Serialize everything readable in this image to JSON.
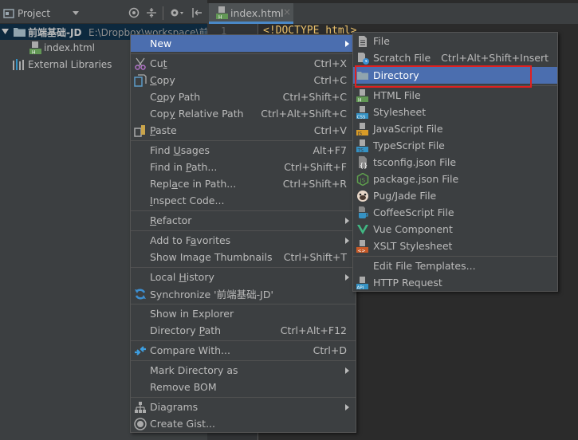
{
  "project_panel": {
    "title": "Project",
    "header_icons": [
      "project-icon",
      "dropdown-icon",
      "locate-icon",
      "collapse-icon",
      "gear-icon",
      "hide-icon"
    ],
    "root": {
      "name": "前端基础-JD",
      "path": "E:\\Dropbox\\workspace\\前"
    },
    "children": [
      {
        "name": "index.html",
        "icon": "html-file-icon"
      }
    ],
    "external": "External Libraries"
  },
  "editor": {
    "tab": {
      "label": "index.html",
      "close": "×"
    },
    "line_number": "1",
    "code_line": "<!DOCTYPE html>"
  },
  "context_menu": {
    "items": [
      {
        "label": "New",
        "submenu": true,
        "selected": true
      },
      {
        "sep": true
      },
      {
        "label": "Cut",
        "ul": "t",
        "shortcut": "Ctrl+X",
        "icon": "scissors-icon"
      },
      {
        "label": "Copy",
        "ul": "C",
        "shortcut": "Ctrl+C",
        "icon": "copy-icon"
      },
      {
        "label": "Copy Path",
        "shortcut": "Ctrl+Shift+C"
      },
      {
        "label": "Copy Relative Path",
        "shortcut": "Ctrl+Alt+Shift+C"
      },
      {
        "label": "Paste",
        "ul": "P",
        "shortcut": "Ctrl+V",
        "icon": "paste-icon"
      },
      {
        "sep": true
      },
      {
        "label": "Find Usages",
        "shortcut": "Alt+F7"
      },
      {
        "label": "Find in Path...",
        "shortcut": "Ctrl+Shift+F"
      },
      {
        "label": "Replace in Path...",
        "shortcut": "Ctrl+Shift+R"
      },
      {
        "label": "Inspect Code..."
      },
      {
        "sep": true
      },
      {
        "label": "Refactor",
        "submenu": true
      },
      {
        "sep": true
      },
      {
        "label": "Add to Favorites",
        "submenu": true
      },
      {
        "label": "Show Image Thumbnails",
        "shortcut": "Ctrl+Shift+T"
      },
      {
        "sep": true
      },
      {
        "label": "Local History",
        "submenu": true
      },
      {
        "label": "Synchronize '前端基础-JD'",
        "icon": "sync-icon"
      },
      {
        "sep": true
      },
      {
        "label": "Show in Explorer"
      },
      {
        "label": "Directory Path",
        "shortcut": "Ctrl+Alt+F12"
      },
      {
        "sep": true
      },
      {
        "label": "Compare With...",
        "shortcut": "Ctrl+D",
        "icon": "compare-icon"
      },
      {
        "sep": true
      },
      {
        "label": "Mark Directory as",
        "submenu": true
      },
      {
        "label": "Remove BOM"
      },
      {
        "sep": true
      },
      {
        "label": "Diagrams",
        "submenu": true,
        "icon": "diagram-icon"
      },
      {
        "label": "Create Gist...",
        "icon": "github-icon"
      }
    ]
  },
  "new_submenu": {
    "items": [
      {
        "label": "File",
        "icon": "file-icon"
      },
      {
        "label": "Scratch File",
        "shortcut": "Ctrl+Alt+Shift+Insert",
        "icon": "scratch-file-icon"
      },
      {
        "label": "Directory",
        "icon": "folder-icon",
        "selected": true
      },
      {
        "sep": true
      },
      {
        "label": "HTML File",
        "icon": "html-file-icon",
        "badge": "H",
        "badge_color": "#629755"
      },
      {
        "label": "Stylesheet",
        "icon": "css-file-icon",
        "badge": "CSS",
        "badge_color": "#3592c4"
      },
      {
        "label": "JavaScript File",
        "icon": "js-file-icon",
        "badge": "JS",
        "badge_color": "#d89b28"
      },
      {
        "label": "TypeScript File",
        "icon": "ts-file-icon",
        "badge": "TS",
        "badge_color": "#3592c4"
      },
      {
        "label": "tsconfig.json File",
        "icon": "tsconfig-icon"
      },
      {
        "label": "package.json File",
        "icon": "nodejs-icon"
      },
      {
        "label": "Pug/Jade File",
        "icon": "pug-icon"
      },
      {
        "label": "CoffeeScript File",
        "icon": "coffee-icon"
      },
      {
        "label": "Vue Component",
        "icon": "vue-icon"
      },
      {
        "label": "XSLT Stylesheet",
        "icon": "xslt-icon",
        "badge": "<>",
        "badge_color": "#c75a28"
      },
      {
        "sep": true
      },
      {
        "label": "Edit File Templates..."
      },
      {
        "label": "HTTP Request",
        "icon": "api-icon",
        "badge": "API",
        "badge_color": "#3592c4"
      }
    ]
  },
  "colors": {
    "selection": "#4b6eaf",
    "highlight_box": "#e02020",
    "tree_selection": "#0d293e"
  }
}
